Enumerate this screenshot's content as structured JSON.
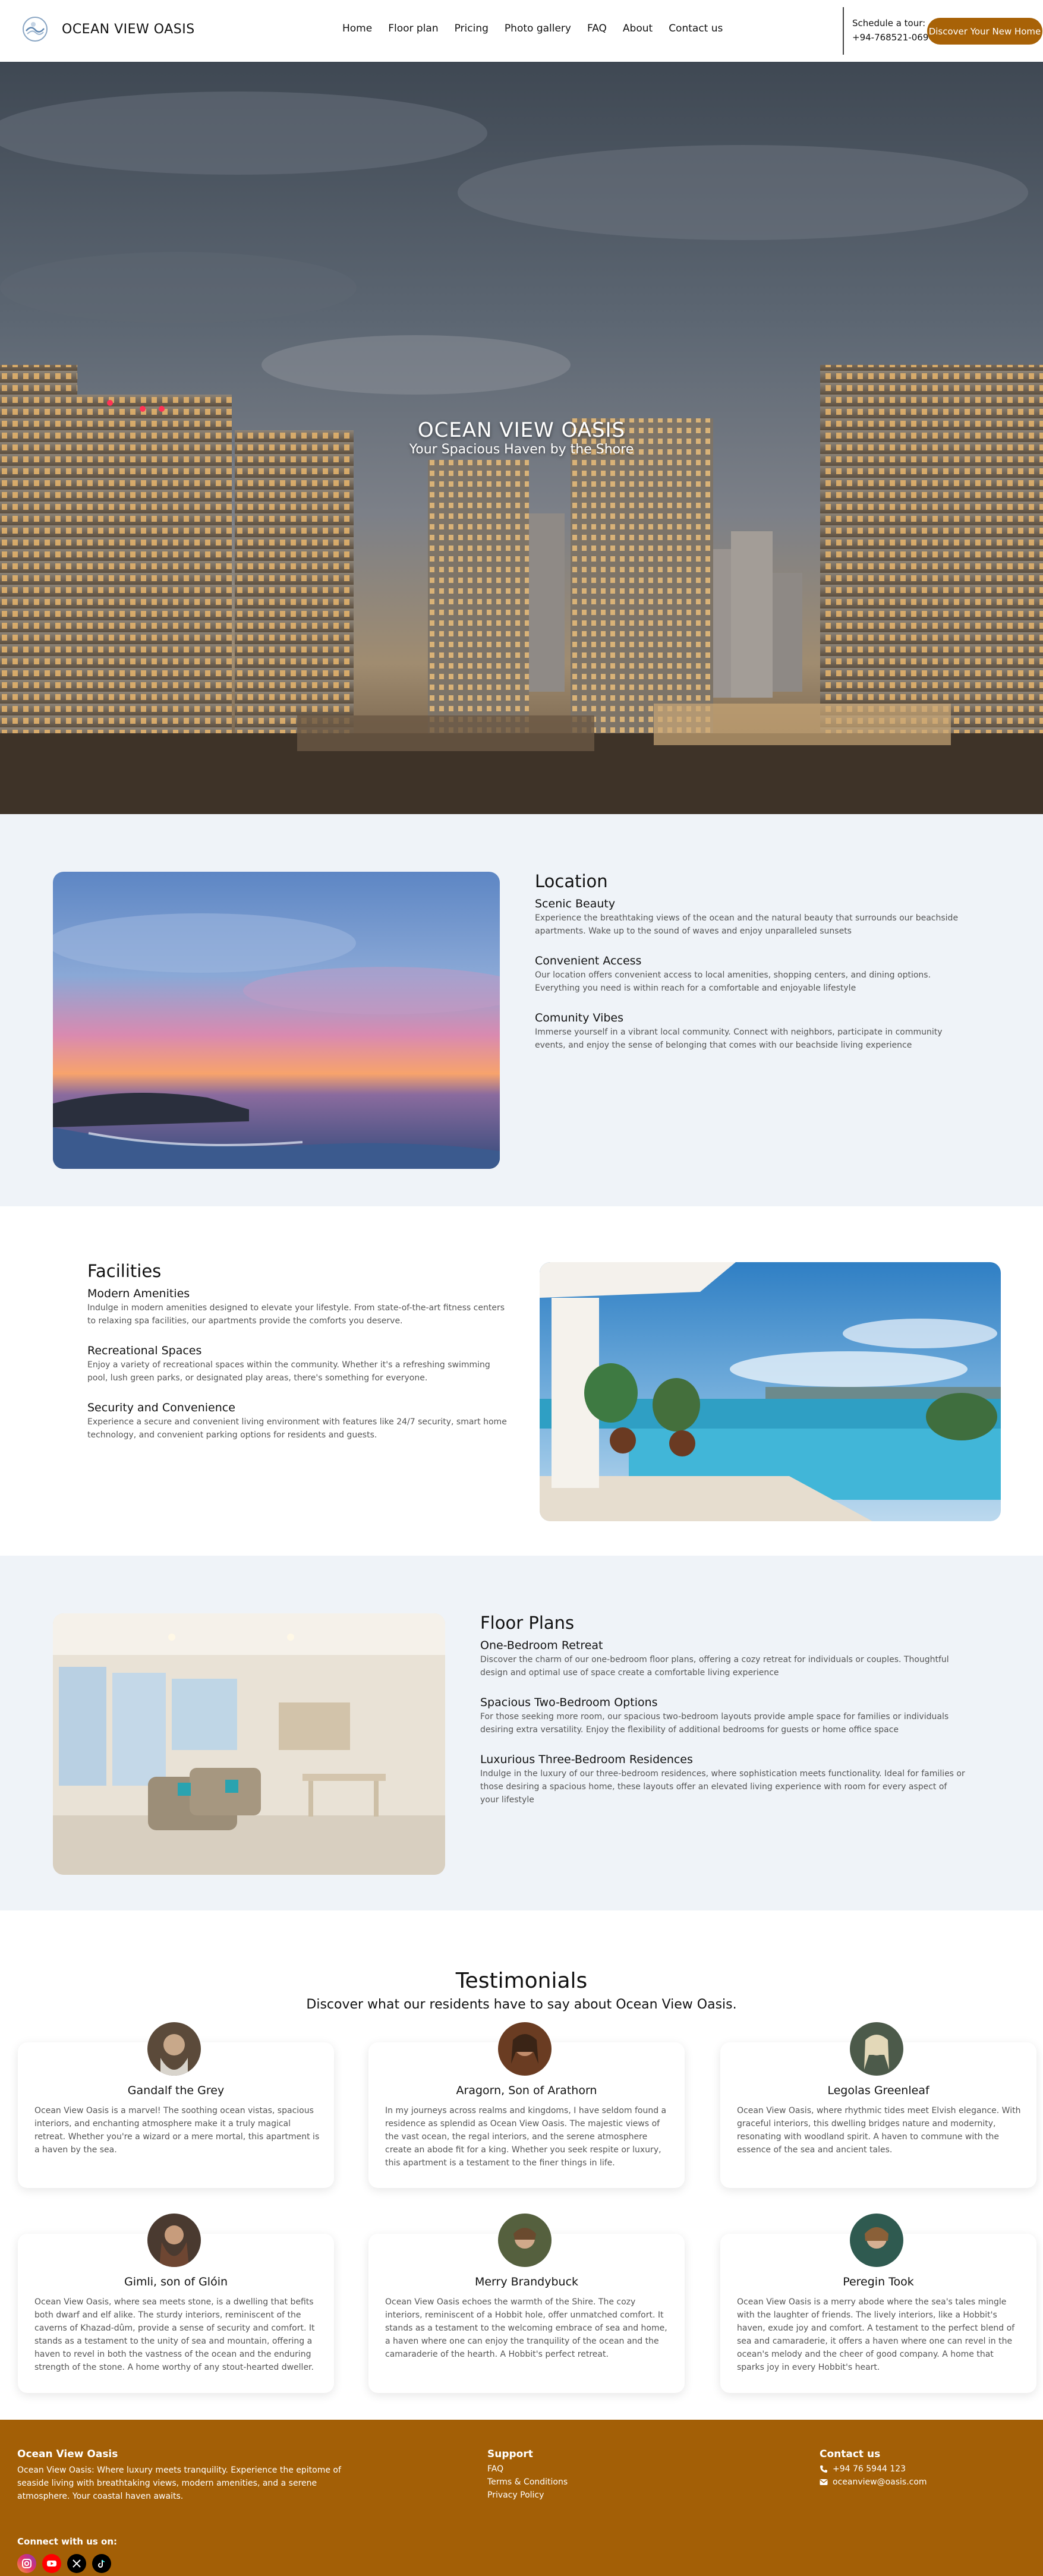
{
  "header": {
    "brand": "OCEAN VIEW OASIS",
    "nav": [
      "Home",
      "Floor plan",
      "Pricing",
      "Photo gallery",
      "FAQ",
      "About",
      "Contact us"
    ],
    "tour_label": "Schedule a tour:",
    "tour_phone": "+94-768521-069",
    "cta": "Discover Your New Home"
  },
  "hero": {
    "title": "OCEAN VIEW OASIS",
    "subtitle": "Your Spacious Haven by the Shore"
  },
  "location": {
    "heading": "Location",
    "items": [
      {
        "title": "Scenic Beauty",
        "text": "Experience the breathtaking views of the ocean and the natural beauty that surrounds our beachside apartments. Wake up to the sound of waves and enjoy unparalleled sunsets"
      },
      {
        "title": "Convenient Access",
        "text": "Our location offers convenient access to local amenities, shopping centers, and dining options. Everything you need is within reach for a comfortable and enjoyable lifestyle"
      },
      {
        "title": "Comunity Vibes",
        "text": "Immerse yourself in a vibrant local community. Connect with neighbors, participate in community events, and enjoy the sense of belonging that comes with our beachside living experience"
      }
    ]
  },
  "facilities": {
    "heading": "Facilities",
    "items": [
      {
        "title": "Modern Amenities",
        "text": "Indulge in modern amenities designed to elevate your lifestyle. From state-of-the-art fitness centers to relaxing spa facilities, our apartments provide the comforts you deserve."
      },
      {
        "title": "Recreational Spaces",
        "text": "Enjoy a variety of recreational spaces within the community. Whether it's a refreshing swimming pool, lush green parks, or designated play areas, there's something for everyone."
      },
      {
        "title": "Security and Convenience",
        "text": "Experience a secure and convenient living environment with features like 24/7 security, smart home technology, and convenient parking options for residents and guests."
      }
    ]
  },
  "floorplans": {
    "heading": "Floor Plans",
    "items": [
      {
        "title": "One-Bedroom Retreat",
        "text": "Discover the charm of our one-bedroom floor plans, offering a cozy retreat for individuals or couples. Thoughtful design and optimal use of space create a comfortable living experience"
      },
      {
        "title": "Spacious Two-Bedroom Options",
        "text": "For those seeking more room, our spacious two-bedroom layouts provide ample space for families or individuals desiring extra versatility. Enjoy the flexibility of additional bedrooms for guests or home office space"
      },
      {
        "title": "Luxurious Three-Bedroom Residences",
        "text": "Indulge in the luxury of our three-bedroom residences, where sophistication meets functionality. Ideal for families or those desiring a spacious home, these layouts offer an elevated living experience with room for every aspect of your lifestyle"
      }
    ]
  },
  "testimonials": {
    "heading": "Testimonials",
    "subheading": "Discover what our residents have to say about Ocean View Oasis.",
    "cards": [
      {
        "name": "Gandalf the Grey",
        "text": "Ocean View Oasis is a marvel! The soothing ocean vistas, spacious interiors, and enchanting atmosphere make it a truly magical retreat. Whether you're a wizard or a mere mortal, this apartment is a haven by the sea."
      },
      {
        "name": "Aragorn, Son of Arathorn",
        "text": "In my journeys across realms and kingdoms, I have seldom found a residence as splendid as Ocean View Oasis. The majestic views of the vast ocean, the regal interiors, and the serene atmosphere create an abode fit for a king. Whether you seek respite or luxury, this apartment is a testament to the finer things in life."
      },
      {
        "name": "Legolas Greenleaf",
        "text": "Ocean View Oasis, where rhythmic tides meet Elvish elegance. With graceful interiors, this dwelling bridges nature and modernity, resonating with woodland spirit. A haven to commune with the essence of the sea and ancient tales."
      },
      {
        "name": "Gimli, son of Glóin",
        "text": "Ocean View Oasis, where sea meets stone, is a dwelling that befits both dwarf and elf alike. The sturdy interiors, reminiscent of the caverns of Khazad-dûm, provide a sense of security and comfort. It stands as a testament to the unity of sea and mountain, offering a haven to revel in both the vastness of the ocean and the enduring strength of the stone. A home worthy of any stout-hearted dweller."
      },
      {
        "name": "Merry Brandybuck",
        "text": "Ocean View Oasis echoes the warmth of the Shire. The cozy interiors, reminiscent of a Hobbit hole, offer unmatched comfort. It stands as a testament to the welcoming embrace of sea and home, a haven where one can enjoy the tranquility of the ocean and the camaraderie of the hearth. A Hobbit's perfect retreat."
      },
      {
        "name": "Peregin Took",
        "text": "Ocean View Oasis is a merry abode where the sea's tales mingle with the laughter of friends. The lively interiors, like a Hobbit's haven, exude joy and comfort. A testament to the perfect blend of sea and camaraderie, it offers a haven where one can revel in the ocean's melody and the cheer of good company. A home that sparks joy in every Hobbit's heart."
      }
    ]
  },
  "footer": {
    "brand": "Ocean View Oasis",
    "about": "Ocean View Oasis: Where luxury meets tranquility. Experience the epitome of seaside living with breathtaking views, modern amenities, and a serene atmosphere. Your coastal haven awaits.",
    "connect": "Connect with us on:",
    "support_heading": "Support",
    "support_links": [
      "FAQ",
      "Terms & Conditions",
      "Privacy Policy"
    ],
    "contact_heading": "Contact us",
    "phone": "+94 76 5944 123",
    "email": "oceanview@oasis.com",
    "colors": {
      "instagram": "#e1306c",
      "youtube": "#ff0000",
      "x": "#000000",
      "tiktok": "#000000"
    }
  }
}
